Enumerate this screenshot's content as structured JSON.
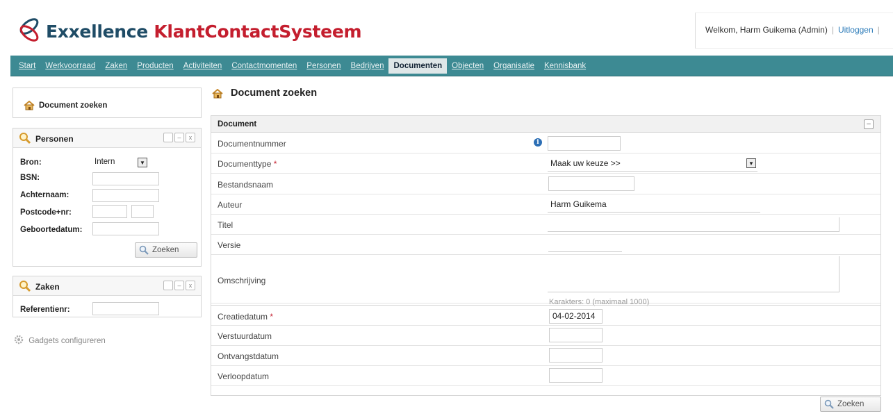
{
  "header": {
    "brand_part1": "Exxellence",
    "brand_part2": "KlantContactSysteem",
    "welcome": "Welkom, Harm Guikema (Admin)",
    "logout": "Uitloggen",
    "trailing_sep": "|"
  },
  "nav": {
    "items": [
      {
        "label": "Start"
      },
      {
        "label": "Werkvoorraad"
      },
      {
        "label": "Zaken"
      },
      {
        "label": "Producten"
      },
      {
        "label": "Activiteiten"
      },
      {
        "label": "Contactmomenten"
      },
      {
        "label": "Personen"
      },
      {
        "label": "Bedrijven"
      },
      {
        "label": "Documenten"
      },
      {
        "label": "Objecten"
      },
      {
        "label": "Organisatie"
      },
      {
        "label": "Kennisbank"
      }
    ],
    "active": "Documenten"
  },
  "left": {
    "doc_search": "Document zoeken",
    "personen": {
      "title": "Personen",
      "bron_label": "Bron:",
      "bron_value": "Intern",
      "bsn_label": "BSN:",
      "achternaam_label": "Achternaam:",
      "postcode_label": "Postcode+nr:",
      "geboortedatum_label": "Geboortedatum:",
      "zoeken": "Zoeken"
    },
    "zaken": {
      "title": "Zaken",
      "referentie_label": "Referentienr:"
    },
    "gadgets": "Gadgets configureren"
  },
  "main": {
    "title": "Document zoeken",
    "section": "Document",
    "rows": {
      "nummer": "Documentnummer",
      "type": "Documenttype",
      "type_value": "Maak uw keuze >>",
      "bestandsnaam": "Bestandsnaam",
      "auteur": "Auteur",
      "auteur_value": "Harm Guikema",
      "titel": "Titel",
      "versie": "Versie",
      "omschrijving": "Omschrijving",
      "chars": "Karakters: 0 (maximaal 1000)",
      "creatiedatum": "Creatiedatum",
      "creatiedatum_value": "04-02-2014",
      "verstuurdatum": "Verstuurdatum",
      "ontvangstdatum": "Ontvangstdatum",
      "verloopdatum": "Verloopdatum"
    },
    "required_marker": "*",
    "zoeken": "Zoeken"
  },
  "colors": {
    "nav": "#3d8a93",
    "brand_dark": "#1f4c66",
    "brand_red": "#c41e2e",
    "link": "#2a7ab8"
  }
}
